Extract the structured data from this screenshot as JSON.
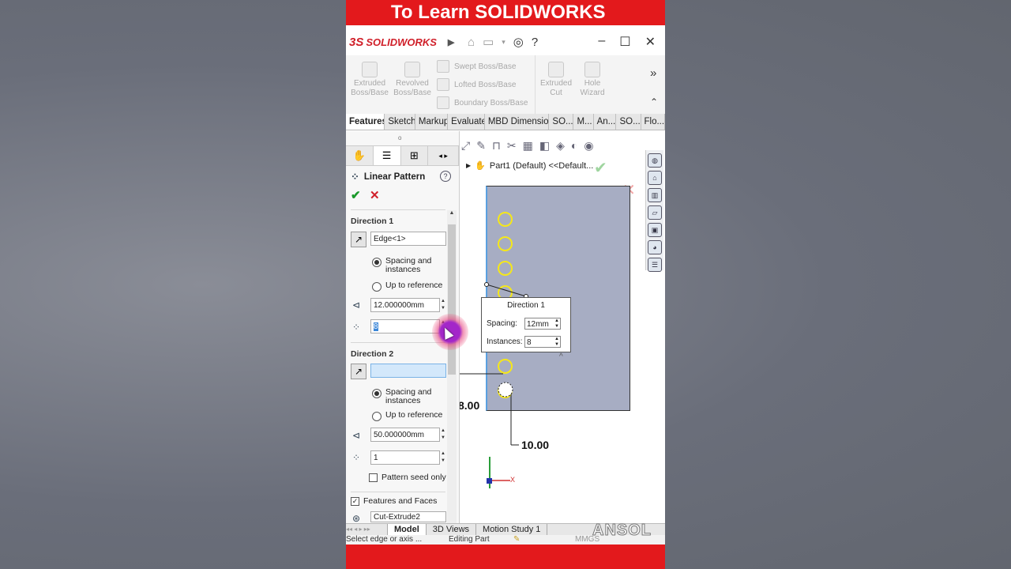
{
  "banner": {
    "text": "To Learn SOLIDWORKS"
  },
  "app": {
    "logo_text": "SOLIDWORKS",
    "logo_mark": "3S"
  },
  "ribbon": {
    "extruded_boss": "Extruded Boss/Base",
    "revolved_boss": "Revolved Boss/Base",
    "swept_boss": "Swept Boss/Base",
    "lofted_boss": "Lofted Boss/Base",
    "boundary_boss": "Boundary Boss/Base",
    "extruded_cut": "Extruded Cut",
    "hole_wizard": "Hole Wizard",
    "more": "»"
  },
  "tabs": [
    "Features",
    "Sketch",
    "Markup",
    "Evaluate",
    "MBD Dimensio...",
    "SO...",
    "M...",
    "An...",
    "SO...",
    "Flo..."
  ],
  "property_manager": {
    "title": "Linear Pattern",
    "direction1": {
      "label": "Direction 1",
      "edge": "Edge<1>",
      "opt_spacing": "Spacing and instances",
      "opt_reference": "Up to reference",
      "spacing": "12.000000mm",
      "instances": "8"
    },
    "direction2": {
      "label": "Direction 2",
      "edge": "",
      "opt_spacing": "Spacing and instances",
      "opt_reference": "Up to reference",
      "spacing": "50.000000mm",
      "instances": "1",
      "seed_only": "Pattern seed only"
    },
    "features_faces": {
      "label": "Features and Faces",
      "item": "Cut-Extrude2"
    }
  },
  "viewport": {
    "tree_label": "Part1 (Default) <<Default...",
    "popup": {
      "title": "Direction 1",
      "spacing_label": "Spacing:",
      "spacing_value": "12mm",
      "instances_label": "Instances:",
      "instances_value": "8"
    },
    "dim_left": "8.00",
    "dim_bottom": "10.00",
    "axis_x": "X",
    "holes": 8
  },
  "bottom_tabs": [
    "Model",
    "3D Views",
    "Motion Study 1"
  ],
  "status": {
    "left": "Select edge or axis ...",
    "mid": "Editing Part",
    "right": "MMGS"
  },
  "watermark": "ANSOL",
  "colors": {
    "accent_red": "#e3191c",
    "plate": "#a7adc3",
    "hole": "#f5e71a"
  }
}
